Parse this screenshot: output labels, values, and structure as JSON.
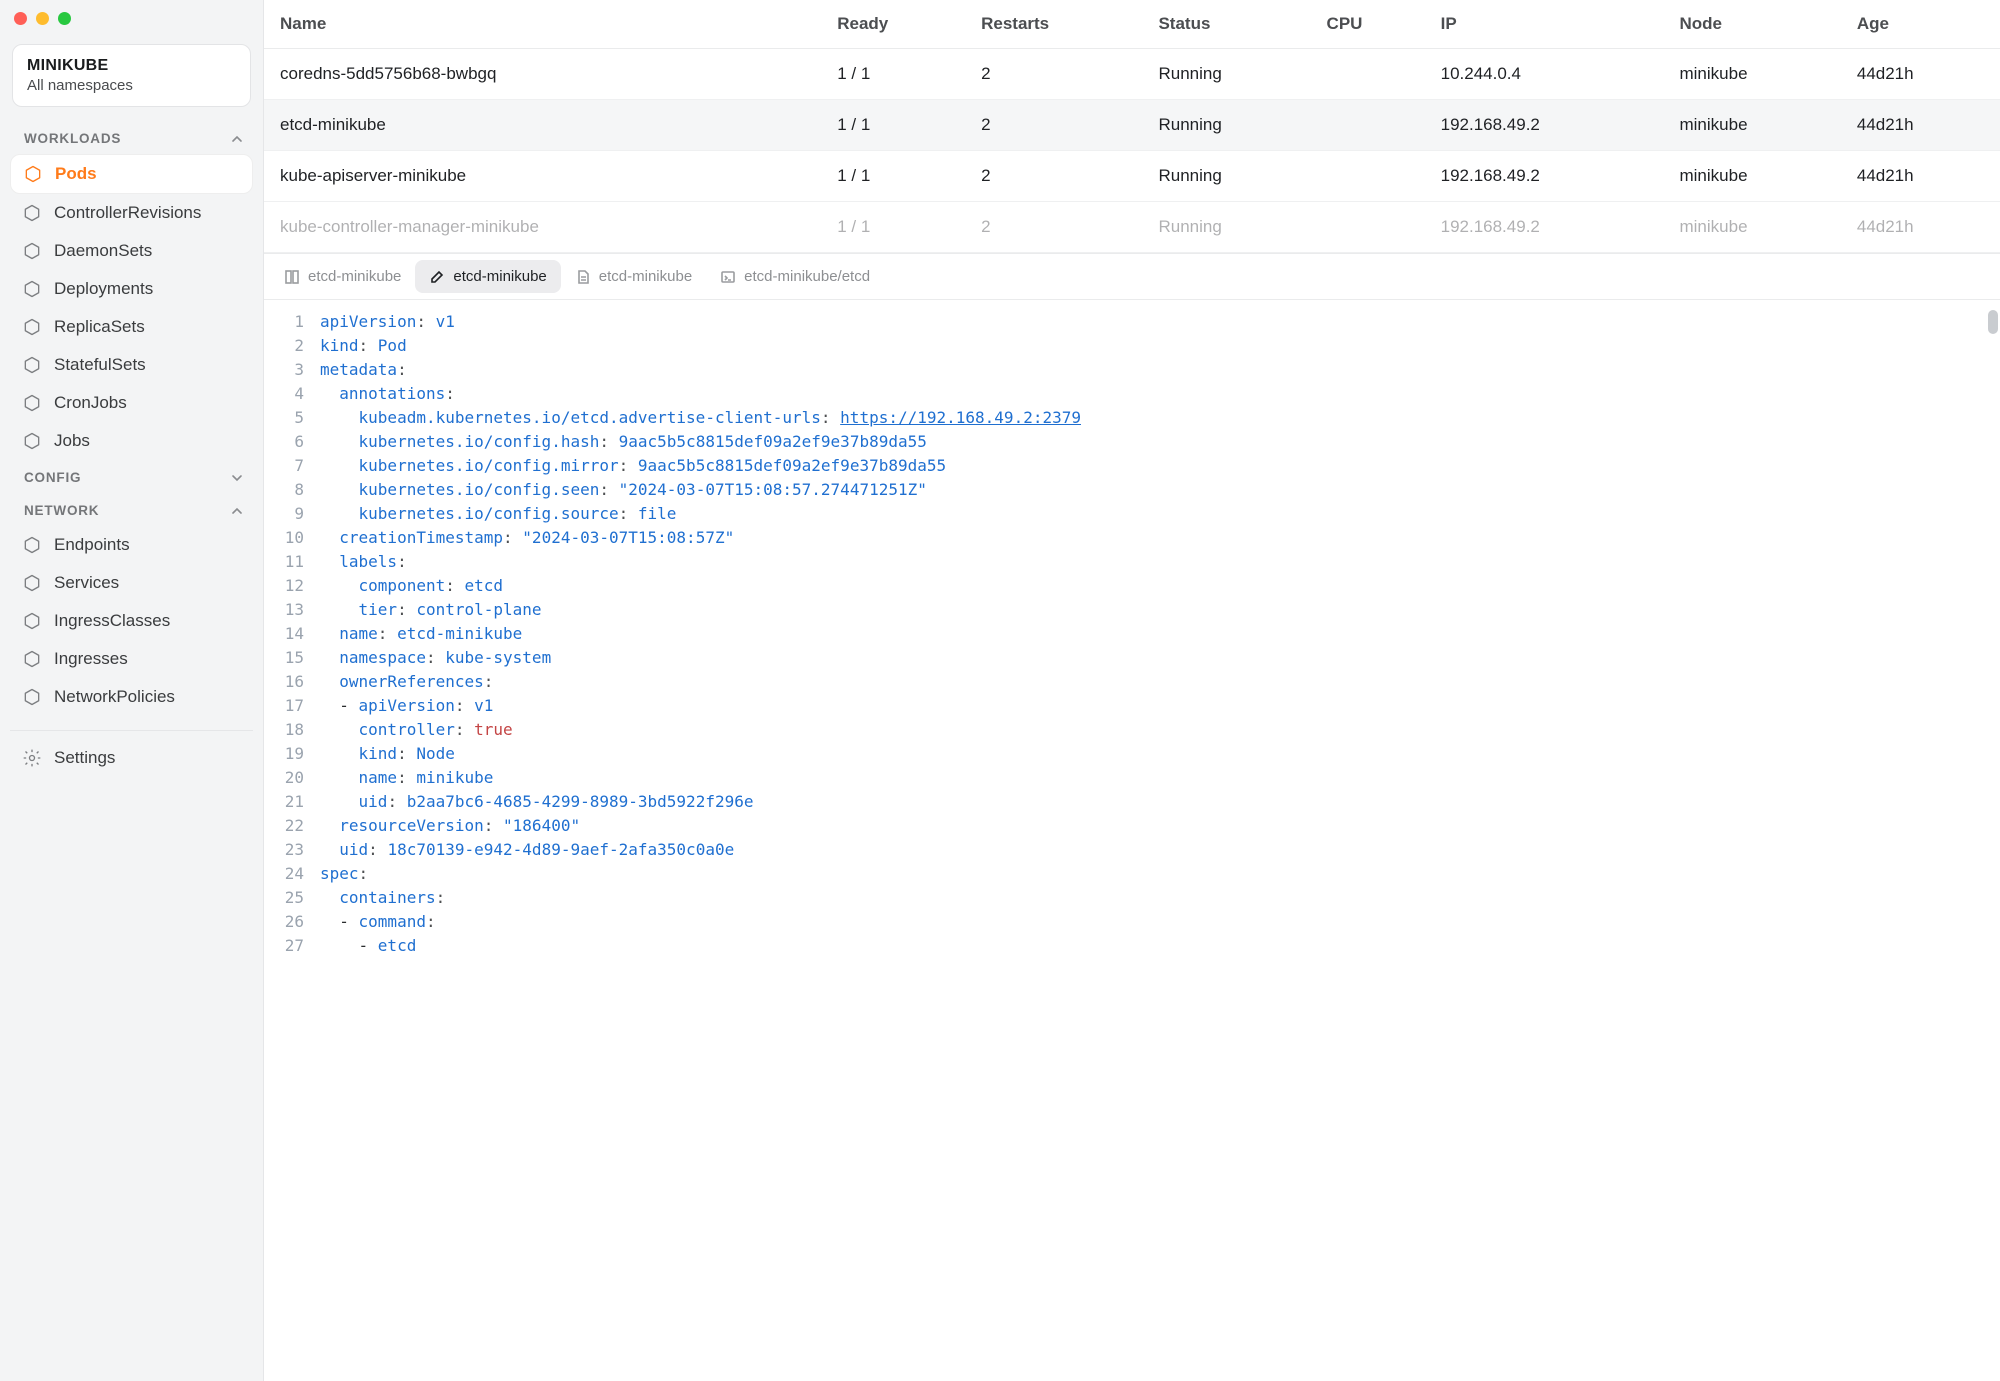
{
  "context": {
    "title": "MINIKUBE",
    "sub": "All namespaces"
  },
  "sections": {
    "workloads": {
      "label": "WORKLOADS",
      "open": true,
      "items": [
        {
          "id": "pods",
          "label": "Pods",
          "active": true
        },
        {
          "id": "controllerrevisions",
          "label": "ControllerRevisions"
        },
        {
          "id": "daemonsets",
          "label": "DaemonSets"
        },
        {
          "id": "deployments",
          "label": "Deployments"
        },
        {
          "id": "replicasets",
          "label": "ReplicaSets"
        },
        {
          "id": "statefulsets",
          "label": "StatefulSets"
        },
        {
          "id": "cronjobs",
          "label": "CronJobs"
        },
        {
          "id": "jobs",
          "label": "Jobs"
        }
      ]
    },
    "config": {
      "label": "CONFIG",
      "open": false
    },
    "network": {
      "label": "NETWORK",
      "open": true,
      "items": [
        {
          "id": "endpoints",
          "label": "Endpoints"
        },
        {
          "id": "services",
          "label": "Services"
        },
        {
          "id": "ingressclasses",
          "label": "IngressClasses"
        },
        {
          "id": "ingresses",
          "label": "Ingresses"
        },
        {
          "id": "networkpolicies",
          "label": "NetworkPolicies"
        }
      ]
    }
  },
  "settingsLabel": "Settings",
  "table": {
    "columns": [
      "Name",
      "Ready",
      "Restarts",
      "Status",
      "CPU",
      "IP",
      "Node",
      "Age"
    ],
    "rows": [
      {
        "name": "coredns-5dd5756b68-bwbgq",
        "ready": "1 / 1",
        "restarts": "2",
        "status": "Running",
        "cpu": "",
        "ip": "10.244.0.4",
        "node": "minikube",
        "age": "44d21h",
        "sel": false
      },
      {
        "name": "etcd-minikube",
        "ready": "1 / 1",
        "restarts": "2",
        "status": "Running",
        "cpu": "",
        "ip": "192.168.49.2",
        "node": "minikube",
        "age": "44d21h",
        "sel": true
      },
      {
        "name": "kube-apiserver-minikube",
        "ready": "1 / 1",
        "restarts": "2",
        "status": "Running",
        "cpu": "",
        "ip": "192.168.49.2",
        "node": "minikube",
        "age": "44d21h",
        "sel": false
      },
      {
        "name": "kube-controller-manager-minikube",
        "ready": "1 / 1",
        "restarts": "2",
        "status": "Running",
        "cpu": "",
        "ip": "192.168.49.2",
        "node": "minikube",
        "age": "44d21h",
        "sel": false,
        "cut": true
      }
    ]
  },
  "tabs": [
    {
      "icon": "columns",
      "label": "etcd-minikube",
      "active": false
    },
    {
      "icon": "pencil",
      "label": "etcd-minikube",
      "active": true
    },
    {
      "icon": "doc",
      "label": "etcd-minikube",
      "active": false
    },
    {
      "icon": "terminal",
      "label": "etcd-minikube/etcd",
      "active": false
    }
  ],
  "yaml": [
    [
      [
        "key",
        "apiVersion"
      ],
      [
        "punc",
        ": "
      ],
      [
        "str",
        "v1"
      ]
    ],
    [
      [
        "key",
        "kind"
      ],
      [
        "punc",
        ": "
      ],
      [
        "str",
        "Pod"
      ]
    ],
    [
      [
        "key",
        "metadata"
      ],
      [
        "punc",
        ":"
      ]
    ],
    [
      [
        "pad",
        "  "
      ],
      [
        "key",
        "annotations"
      ],
      [
        "punc",
        ":"
      ]
    ],
    [
      [
        "pad",
        "    "
      ],
      [
        "key",
        "kubeadm.kubernetes.io/etcd.advertise-client-urls"
      ],
      [
        "punc",
        ": "
      ],
      [
        "link",
        "https://192.168.49.2:2379"
      ]
    ],
    [
      [
        "pad",
        "    "
      ],
      [
        "key",
        "kubernetes.io/config.hash"
      ],
      [
        "punc",
        ": "
      ],
      [
        "str",
        "9aac5b5c8815def09a2ef9e37b89da55"
      ]
    ],
    [
      [
        "pad",
        "    "
      ],
      [
        "key",
        "kubernetes.io/config.mirror"
      ],
      [
        "punc",
        ": "
      ],
      [
        "str",
        "9aac5b5c8815def09a2ef9e37b89da55"
      ]
    ],
    [
      [
        "pad",
        "    "
      ],
      [
        "key",
        "kubernetes.io/config.seen"
      ],
      [
        "punc",
        ": "
      ],
      [
        "str",
        "\"2024-03-07T15:08:57.274471251Z\""
      ]
    ],
    [
      [
        "pad",
        "    "
      ],
      [
        "key",
        "kubernetes.io/config.source"
      ],
      [
        "punc",
        ": "
      ],
      [
        "str",
        "file"
      ]
    ],
    [
      [
        "pad",
        "  "
      ],
      [
        "key",
        "creationTimestamp"
      ],
      [
        "punc",
        ": "
      ],
      [
        "str",
        "\"2024-03-07T15:08:57Z\""
      ]
    ],
    [
      [
        "pad",
        "  "
      ],
      [
        "key",
        "labels"
      ],
      [
        "punc",
        ":"
      ]
    ],
    [
      [
        "pad",
        "    "
      ],
      [
        "key",
        "component"
      ],
      [
        "punc",
        ": "
      ],
      [
        "str",
        "etcd"
      ]
    ],
    [
      [
        "pad",
        "    "
      ],
      [
        "key",
        "tier"
      ],
      [
        "punc",
        ": "
      ],
      [
        "str",
        "control-plane"
      ]
    ],
    [
      [
        "pad",
        "  "
      ],
      [
        "key",
        "name"
      ],
      [
        "punc",
        ": "
      ],
      [
        "str",
        "etcd-minikube"
      ]
    ],
    [
      [
        "pad",
        "  "
      ],
      [
        "key",
        "namespace"
      ],
      [
        "punc",
        ": "
      ],
      [
        "str",
        "kube-system"
      ]
    ],
    [
      [
        "pad",
        "  "
      ],
      [
        "key",
        "ownerReferences"
      ],
      [
        "punc",
        ":"
      ]
    ],
    [
      [
        "pad",
        "  - "
      ],
      [
        "key",
        "apiVersion"
      ],
      [
        "punc",
        ": "
      ],
      [
        "str",
        "v1"
      ]
    ],
    [
      [
        "pad",
        "    "
      ],
      [
        "key",
        "controller"
      ],
      [
        "punc",
        ": "
      ],
      [
        "bool",
        "true"
      ]
    ],
    [
      [
        "pad",
        "    "
      ],
      [
        "key",
        "kind"
      ],
      [
        "punc",
        ": "
      ],
      [
        "str",
        "Node"
      ]
    ],
    [
      [
        "pad",
        "    "
      ],
      [
        "key",
        "name"
      ],
      [
        "punc",
        ": "
      ],
      [
        "str",
        "minikube"
      ]
    ],
    [
      [
        "pad",
        "    "
      ],
      [
        "key",
        "uid"
      ],
      [
        "punc",
        ": "
      ],
      [
        "str",
        "b2aa7bc6-4685-4299-8989-3bd5922f296e"
      ]
    ],
    [
      [
        "pad",
        "  "
      ],
      [
        "key",
        "resourceVersion"
      ],
      [
        "punc",
        ": "
      ],
      [
        "str",
        "\"186400\""
      ]
    ],
    [
      [
        "pad",
        "  "
      ],
      [
        "key",
        "uid"
      ],
      [
        "punc",
        ": "
      ],
      [
        "str",
        "18c70139-e942-4d89-9aef-2afa350c0a0e"
      ]
    ],
    [
      [
        "key",
        "spec"
      ],
      [
        "punc",
        ":"
      ]
    ],
    [
      [
        "pad",
        "  "
      ],
      [
        "key",
        "containers"
      ],
      [
        "punc",
        ":"
      ]
    ],
    [
      [
        "pad",
        "  - "
      ],
      [
        "key",
        "command"
      ],
      [
        "punc",
        ":"
      ]
    ],
    [
      [
        "pad",
        "    - "
      ],
      [
        "str",
        "etcd"
      ]
    ]
  ]
}
